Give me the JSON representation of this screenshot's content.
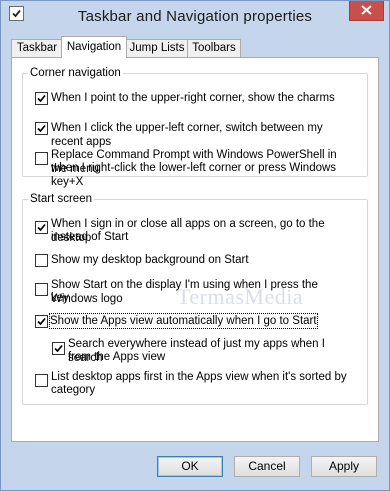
{
  "window": {
    "title": "Taskbar and Navigation properties"
  },
  "tabs": [
    {
      "label": "Taskbar",
      "active": false
    },
    {
      "label": "Navigation",
      "active": true
    },
    {
      "label": "Jump Lists",
      "active": false
    },
    {
      "label": "Toolbars",
      "active": false
    }
  ],
  "corner_navigation": {
    "title": "Corner navigation",
    "options": [
      {
        "lines": [
          "When I point to the upper-right corner, show the charms"
        ],
        "checked": true
      },
      {
        "lines": [
          "When I click the upper-left corner, switch between my recent apps"
        ],
        "checked": true
      },
      {
        "lines": [
          "Replace Command Prompt with Windows PowerShell in the menu",
          "when I right-click the lower-left corner or press Windows key+X"
        ],
        "checked": false
      }
    ]
  },
  "start_screen": {
    "title": "Start screen",
    "options": [
      {
        "lines": [
          "When I sign in or close all apps on a screen, go to the desktop",
          "instead of Start"
        ],
        "checked": true
      },
      {
        "lines": [
          "Show my desktop background on Start"
        ],
        "checked": false
      },
      {
        "lines": [
          "Show Start on the display I'm using when I press the Windows logo",
          "key"
        ],
        "checked": false
      },
      {
        "lines": [
          "Show the Apps view automatically when I go to Start"
        ],
        "checked": true
      },
      {
        "lines": [
          "Search everywhere instead of just my apps when I search",
          "from the Apps view"
        ],
        "checked": true
      },
      {
        "lines": [
          "List desktop apps first in the Apps view when it's sorted by",
          "category"
        ],
        "checked": false
      }
    ]
  },
  "watermark": "TermasMedia",
  "buttons": {
    "ok": "OK",
    "cancel": "Cancel",
    "apply": "Apply"
  },
  "colors": {
    "window_frame": "#c5d5eb",
    "close_button": "#c7504a",
    "panel": "#ffffff"
  },
  "icons": {
    "app_icon": "checkbox-window-icon",
    "close_icon": "close-x-icon",
    "check_icon": "checkmark-icon"
  }
}
